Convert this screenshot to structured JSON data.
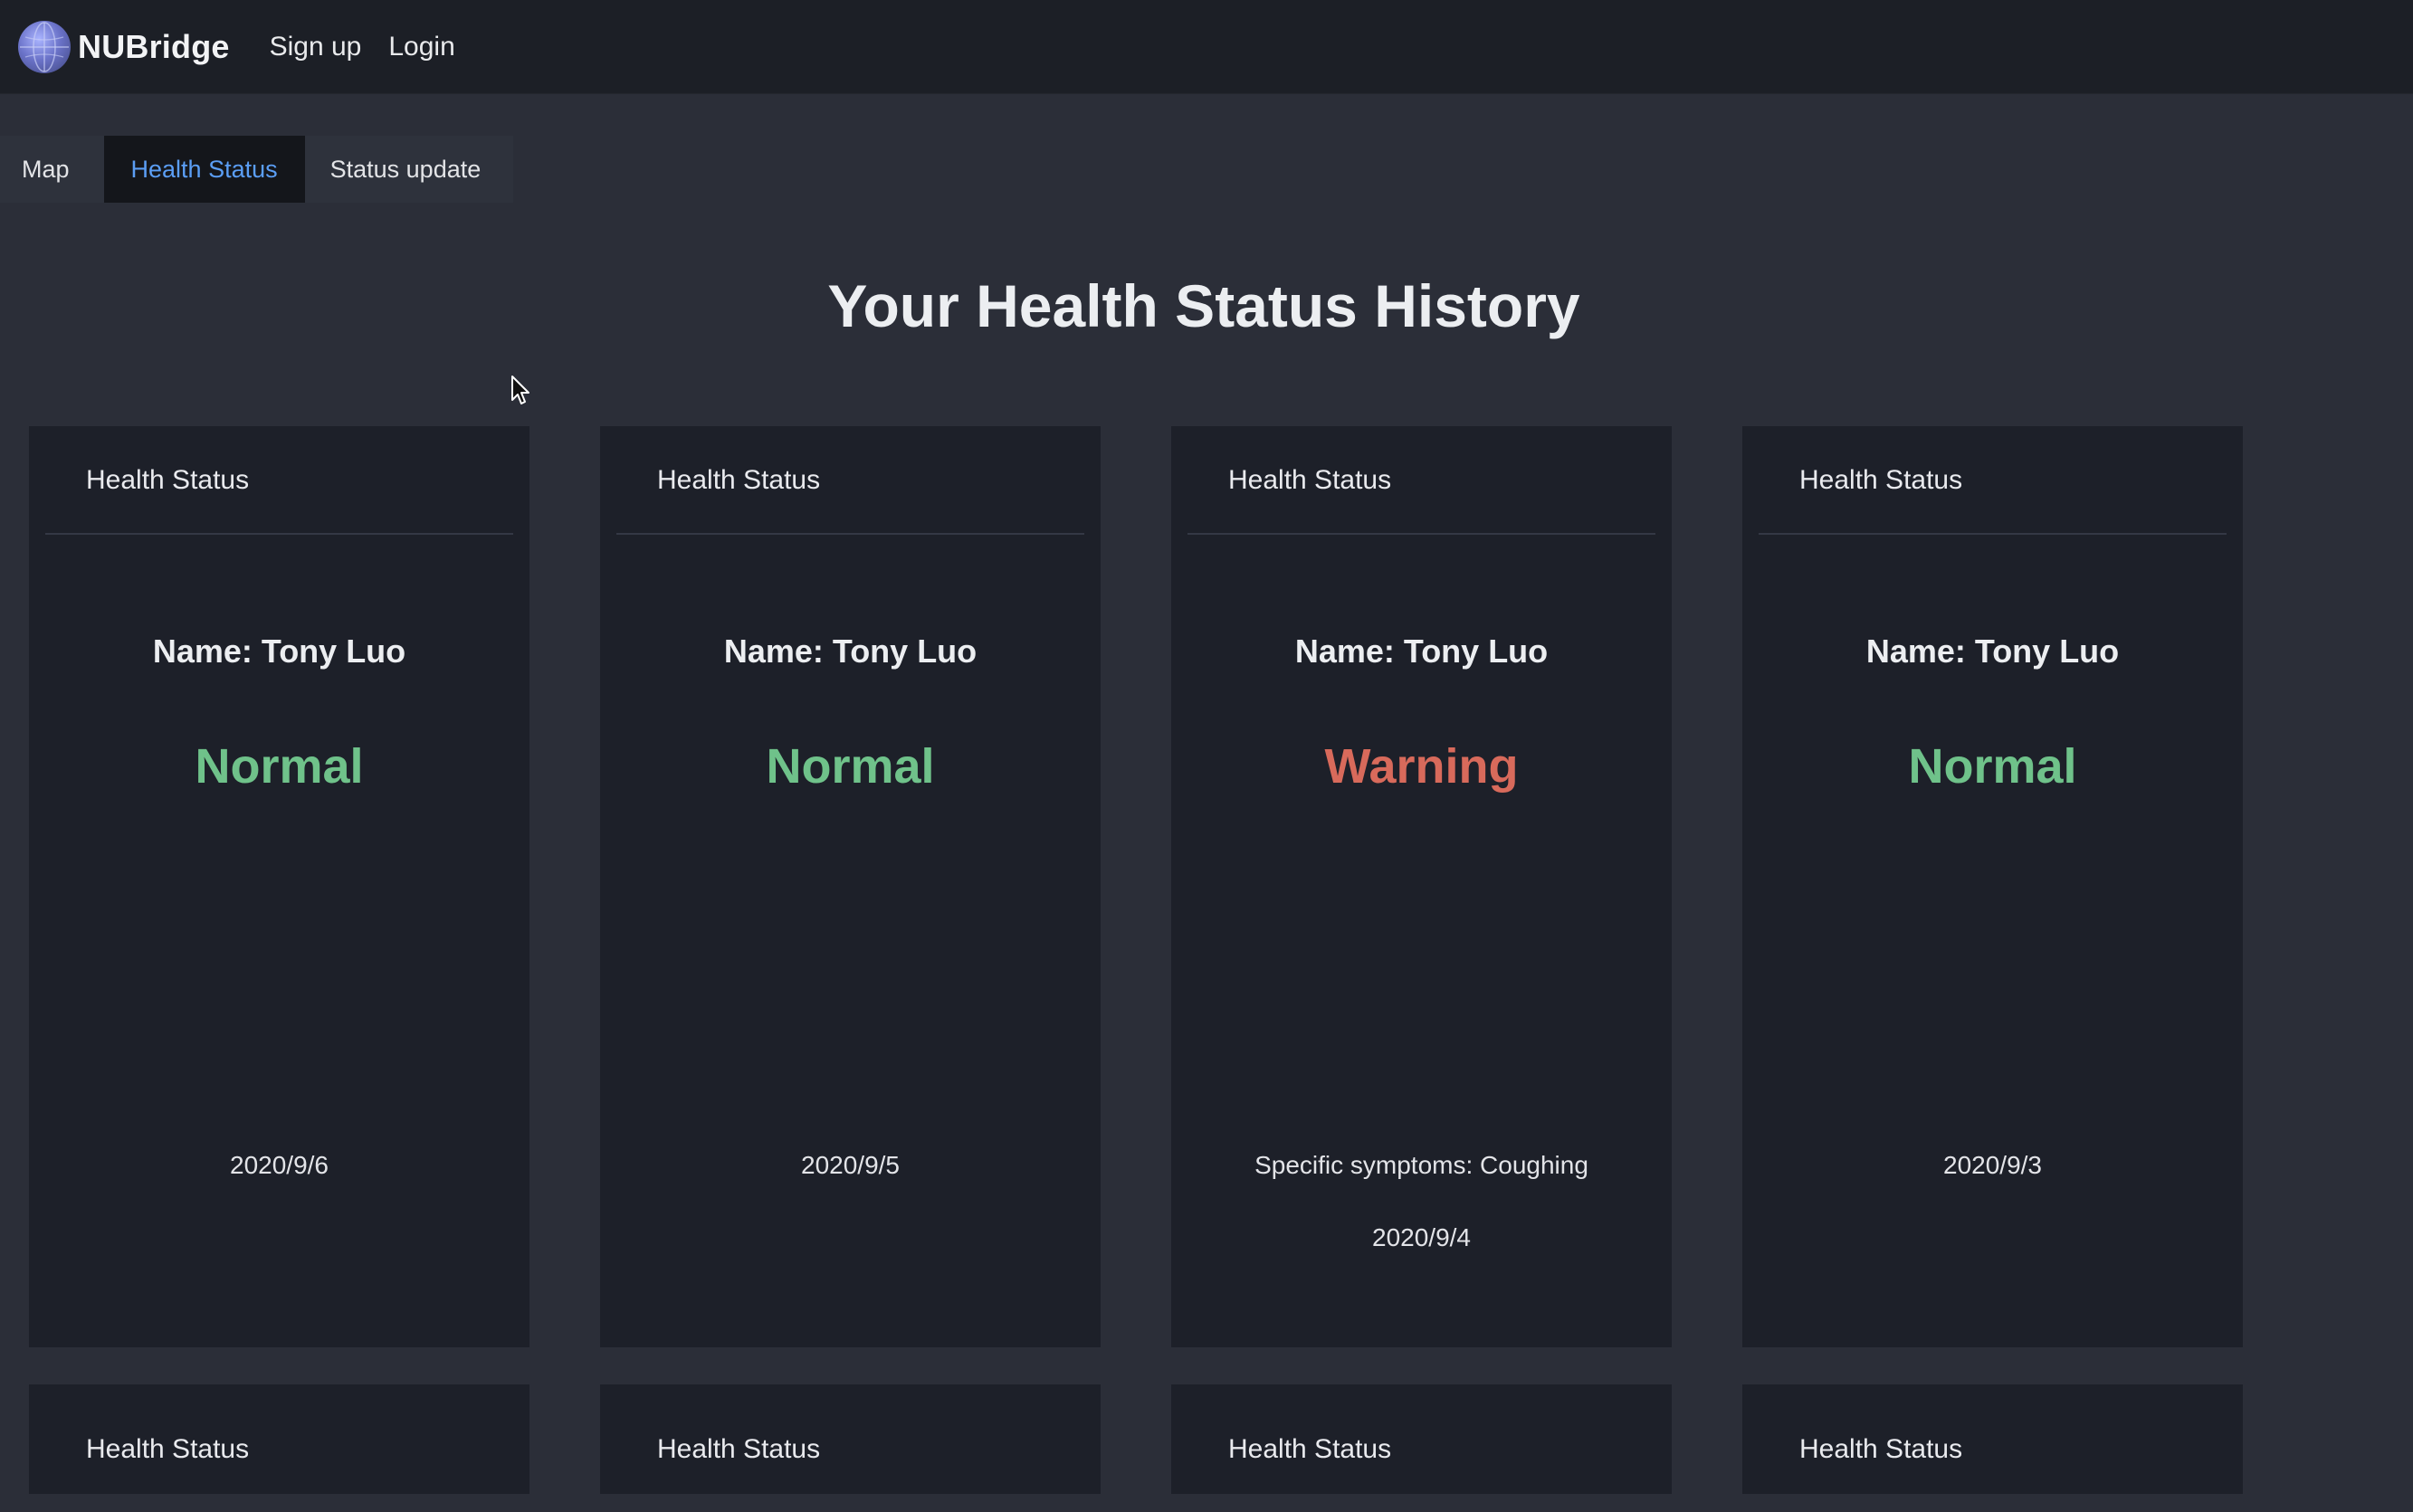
{
  "app": {
    "brand": "NUBridge",
    "nav": {
      "signup": "Sign up",
      "login": "Login"
    }
  },
  "tabs": [
    {
      "label": "Map",
      "active": false
    },
    {
      "label": "Health Status",
      "active": true
    },
    {
      "label": "Status update",
      "active": false
    }
  ],
  "page": {
    "title": "Your Health Status History"
  },
  "cards_row1": [
    {
      "header": "Health Status",
      "name": "Name: Tony Luo",
      "status": "Normal",
      "symptoms": "",
      "date": "2020/9/6"
    },
    {
      "header": "Health Status",
      "name": "Name: Tony Luo",
      "status": "Normal",
      "symptoms": "",
      "date": "2020/9/5"
    },
    {
      "header": "Health Status",
      "name": "Name: Tony Luo",
      "status": "Warning",
      "symptoms": "Specific symptoms: Coughing",
      "date": "2020/9/4"
    },
    {
      "header": "Health Status",
      "name": "Name: Tony Luo",
      "status": "Normal",
      "symptoms": "",
      "date": "2020/9/3"
    }
  ],
  "cards_row2": [
    {
      "header": "Health Status"
    },
    {
      "header": "Health Status"
    },
    {
      "header": "Health Status"
    },
    {
      "header": "Health Status"
    }
  ],
  "colors": {
    "normal": "#6fc28a",
    "warning": "#d86a5b",
    "active_tab_text": "#5b9ef5"
  }
}
